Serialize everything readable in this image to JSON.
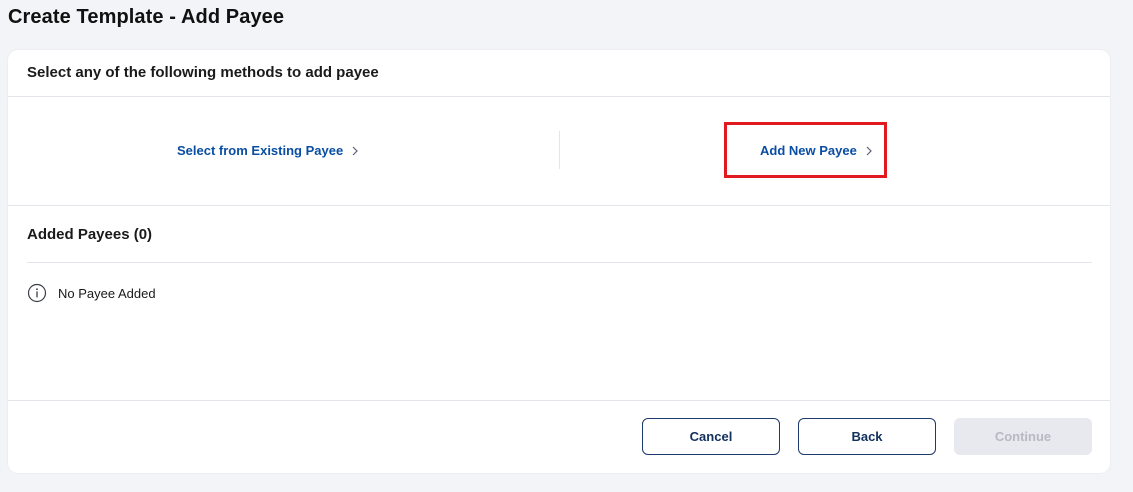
{
  "page": {
    "title": "Create Template - Add Payee"
  },
  "methods": {
    "heading": "Select any of the following methods to add payee",
    "existing_label": "Select from Existing Payee",
    "new_label": "Add New Payee",
    "link_icon": "chevron-right-icon",
    "highlight_color": "#e01a1f",
    "link_color": "#0a4ea3"
  },
  "added": {
    "title": "Added Payees (0)",
    "empty_text": "No Payee Added",
    "empty_icon": "info-icon"
  },
  "footer": {
    "cancel_label": "Cancel",
    "back_label": "Back",
    "continue_label": "Continue"
  }
}
